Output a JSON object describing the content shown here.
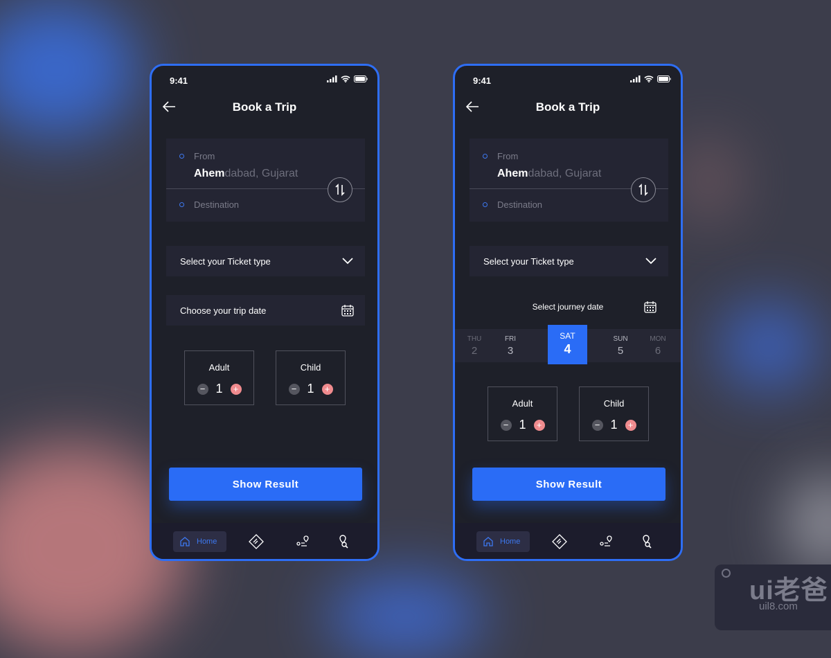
{
  "status_bar": {
    "time": "9:41"
  },
  "header": {
    "title": "Book a Trip"
  },
  "route": {
    "from_label": "From",
    "from_value_typed": "Ahem",
    "from_value_suggested": "dabad, Gujarat",
    "destination_placeholder": "Destination"
  },
  "ticket_type": {
    "label": "Select your Ticket type"
  },
  "trip_date": {
    "label": "Choose your trip date"
  },
  "journey_date": {
    "label": "Select journey date",
    "days": [
      {
        "name": "THU",
        "date": "2"
      },
      {
        "name": "FRI",
        "date": "3"
      },
      {
        "name": "SAT",
        "date": "4",
        "selected": true
      },
      {
        "name": "SUN",
        "date": "5"
      },
      {
        "name": "MON",
        "date": "6"
      }
    ]
  },
  "passengers": {
    "adult": {
      "label": "Adult",
      "count": "1"
    },
    "child": {
      "label": "Child",
      "count": "1"
    },
    "minus": "−",
    "plus": "+"
  },
  "show_result_label": "Show Result",
  "bottom_nav": {
    "home_label": "Home",
    "items": [
      "home-icon",
      "ticket-icon",
      "route-icon",
      "location-search-icon"
    ]
  },
  "colors": {
    "accent": "#2a6cf6",
    "plus": "#f08b8e",
    "background": "#1e2029",
    "card": "#242533"
  },
  "watermark": {
    "logo": "ui老爸",
    "url": "uil8.com"
  }
}
